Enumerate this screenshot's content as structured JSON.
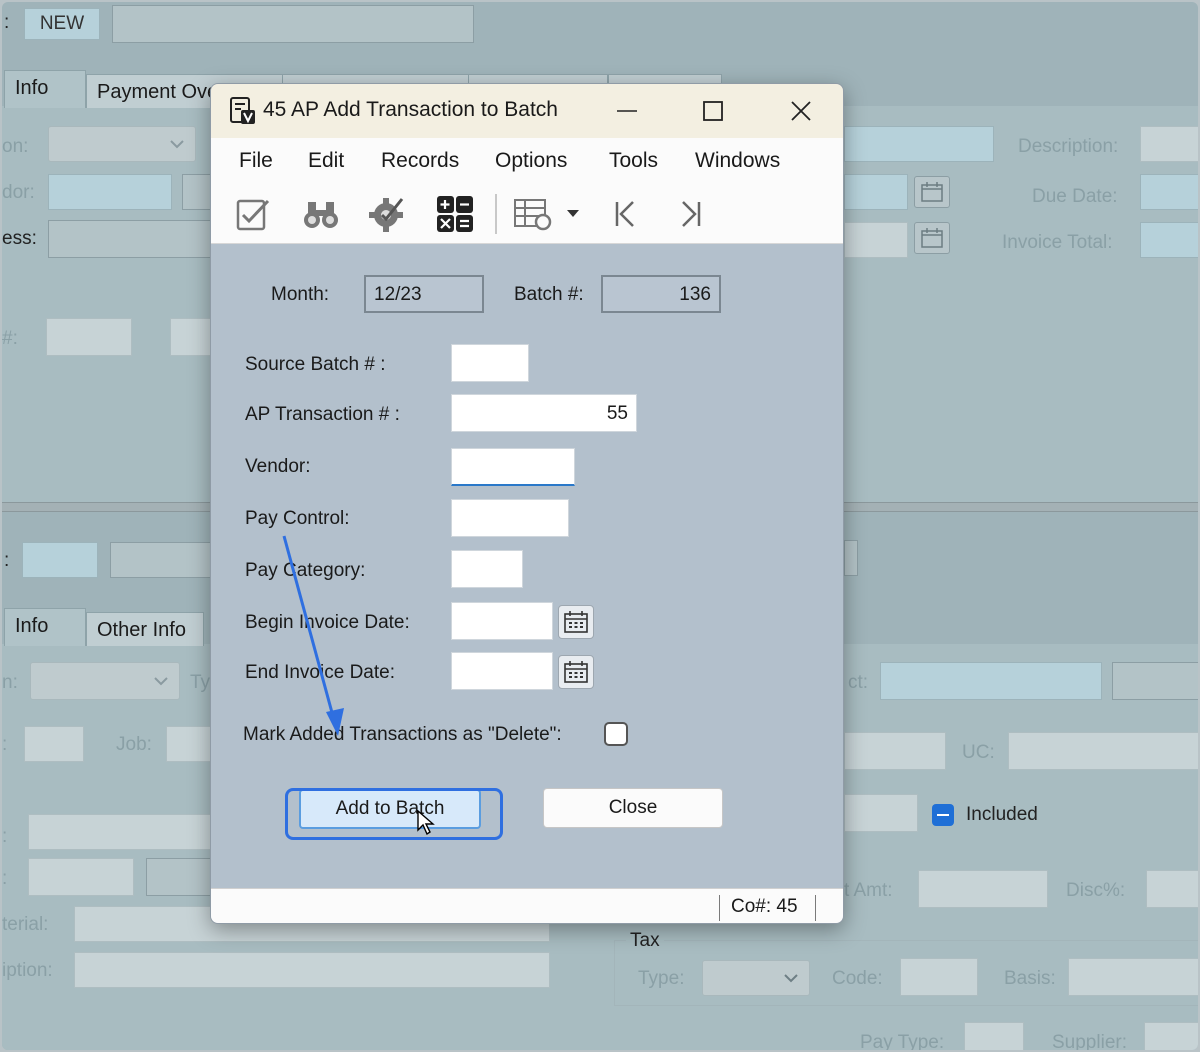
{
  "background": {
    "top_section": {
      "new_field": "NEW",
      "tabs": [
        "Info",
        "Payment Ove"
      ],
      "labels": {
        "location_partial": "on:",
        "vendor_partial": "dor:",
        "address_partial": "ess:",
        "number_partial": "#:",
        "description": "Description:",
        "due_date": "Due Date:",
        "invoice_total": "Invoice Total:"
      }
    },
    "bottom_section": {
      "tabs": [
        "Info",
        "Other Info"
      ],
      "labels": {
        "row1_partial": "n:",
        "row1_type_partial": "Ty",
        "job": "Job:",
        "account_partial": "ct:",
        "uc": "UC:",
        "included": "Included",
        "amount_partial": "t Amt:",
        "disc_pct": "Disc%:",
        "material_partial": "terial:",
        "description_partial": "iption:",
        "tax_group": "Tax",
        "tax_type": "Type:",
        "tax_code": "Code:",
        "tax_basis": "Basis:",
        "pay_type": "Pay Type:",
        "supplier": "Supplier:"
      }
    }
  },
  "dialog": {
    "title": "45 AP Add Transaction to Batch",
    "menu": [
      "File",
      "Edit",
      "Records",
      "Options",
      "Tools",
      "Windows"
    ],
    "toolbar_icons": [
      "edit-checklist-icon",
      "binoculars-icon",
      "gear-check-icon",
      "calculator-icon",
      "grid-settings-icon",
      "dropdown-arrow-icon",
      "first-record-icon",
      "last-record-icon"
    ],
    "month_label": "Month:",
    "month_value": "12/23",
    "batch_label": "Batch #:",
    "batch_value": "136",
    "source_batch_label": "Source Batch # :",
    "source_batch_value": "",
    "ap_transaction_label": "AP Transaction # :",
    "ap_transaction_value": "55",
    "vendor_label": "Vendor:",
    "vendor_value": "",
    "pay_control_label": "Pay Control:",
    "pay_control_value": "",
    "pay_category_label": "Pay Category:",
    "pay_category_value": "",
    "begin_invoice_date_label": "Begin Invoice Date:",
    "begin_invoice_date_value": "",
    "end_invoice_date_label": "End Invoice Date:",
    "end_invoice_date_value": "",
    "mark_delete_label": "Mark Added Transactions as \"Delete\":",
    "mark_delete_checked": false,
    "add_button": "Add to Batch",
    "close_button": "Close",
    "status_company": "Co#: 45"
  },
  "colors": {
    "annotation": "#2f6fe0",
    "primary_button_bg": "#d7e9fa",
    "dialog_bg": "#b3c0cc"
  }
}
